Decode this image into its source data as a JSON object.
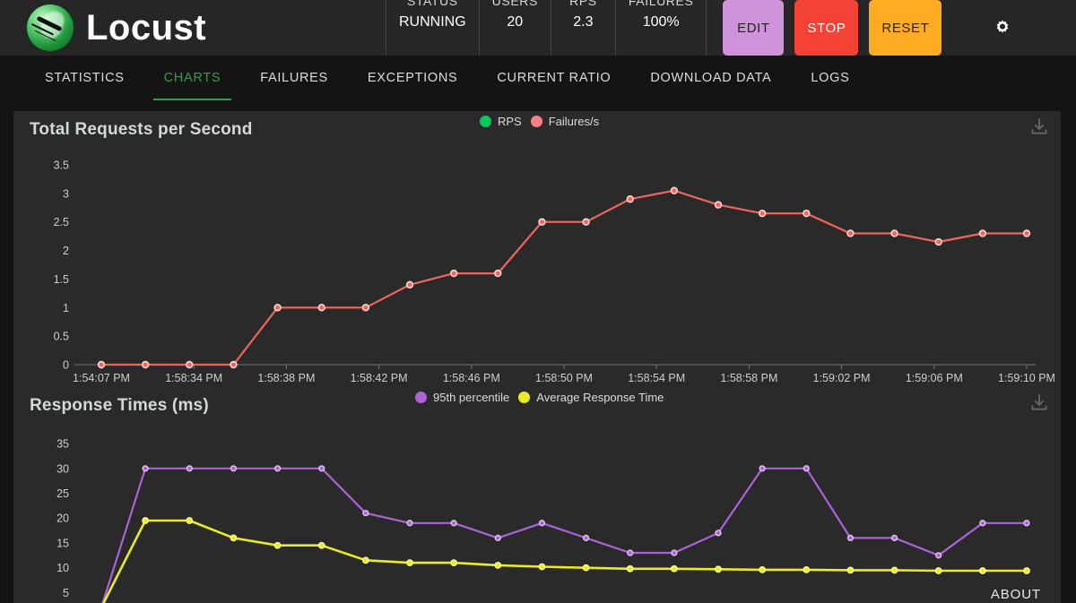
{
  "header": {
    "brand": "Locust",
    "logo_icon": "locust-logo",
    "stats": [
      {
        "label": "STATUS",
        "value": "RUNNING"
      },
      {
        "label": "USERS",
        "value": "20"
      },
      {
        "label": "RPS",
        "value": "2.3"
      },
      {
        "label": "FAILURES",
        "value": "100%"
      }
    ],
    "buttons": {
      "edit": "EDIT",
      "stop": "STOP",
      "reset": "RESET"
    },
    "settings_icon": "gear-icon",
    "colors": {
      "edit": "#ce93d8",
      "stop": "#f44336",
      "reset": "#ffab24",
      "header_bg": "#262626"
    }
  },
  "tabs": {
    "active": "CHARTS",
    "items": [
      {
        "label": "STATISTICS"
      },
      {
        "label": "CHARTS"
      },
      {
        "label": "FAILURES"
      },
      {
        "label": "EXCEPTIONS"
      },
      {
        "label": "CURRENT RATIO"
      },
      {
        "label": "DOWNLOAD DATA"
      },
      {
        "label": "LOGS"
      }
    ]
  },
  "footer": {
    "about_label": "ABOUT"
  },
  "charts": {
    "download_icon": "download-icon"
  },
  "chart_data": [
    {
      "type": "line",
      "title": "Total Requests per Second",
      "xlabel": "",
      "ylabel": "",
      "ylim": [
        0,
        3.5
      ],
      "yticks": [
        0,
        0.5,
        1,
        1.5,
        2,
        2.5,
        3,
        3.5
      ],
      "ytick_labels": [
        "0",
        "0.5",
        "1",
        "1.5",
        "2",
        "2.5",
        "3",
        "3.5"
      ],
      "grid": false,
      "legend_position": "top-center",
      "x": [
        "1:54:07 PM",
        "1:58:34 PM",
        "1:58:38 PM",
        "1:58:42 PM",
        "1:58:46 PM",
        "1:58:50 PM",
        "1:58:54 PM",
        "1:58:58 PM",
        "1:59:02 PM",
        "1:59:06 PM",
        "1:59:10 PM"
      ],
      "xtick_labels": [
        "1:54:07 PM",
        "1:58:34 PM",
        "1:58:38 PM",
        "1:58:42 PM",
        "1:58:46 PM",
        "1:58:50 PM",
        "1:58:54 PM",
        "1:58:58 PM",
        "1:59:02 PM",
        "1:59:06 PM",
        "1:59:10 PM"
      ],
      "series": [
        {
          "name": "RPS",
          "color": "#00ca5a",
          "values": []
        },
        {
          "name": "Failures/s",
          "color": "#ff6d6d",
          "values": [
            0,
            0,
            0,
            0,
            1,
            1,
            1,
            1.4,
            1.6,
            1.6,
            2.5,
            2.5,
            2.9,
            3.05,
            2.8,
            2.65,
            2.65,
            2.3,
            2.3,
            2.15,
            2.3,
            2.3
          ]
        }
      ]
    },
    {
      "type": "line",
      "title": "Response Times (ms)",
      "xlabel": "",
      "ylabel": "",
      "ylim": [
        2,
        37
      ],
      "yticks": [
        5,
        10,
        15,
        20,
        25,
        30,
        35
      ],
      "ytick_labels": [
        "5",
        "10",
        "15",
        "20",
        "25",
        "30",
        "35"
      ],
      "grid": false,
      "legend_position": "top-center",
      "series": [
        {
          "name": "95th percentile",
          "color": "#ab63d6",
          "values": [
            2,
            30,
            30,
            30,
            30,
            30,
            21,
            19,
            19,
            16,
            19,
            16,
            13,
            13,
            17,
            30,
            30,
            16,
            16,
            12.5,
            19,
            19
          ]
        },
        {
          "name": "Average Response Time",
          "color": "#eaec21",
          "values": [
            2,
            19.5,
            19.5,
            16,
            14.5,
            14.5,
            11.5,
            11,
            11,
            10.5,
            10.2,
            10,
            9.8,
            9.8,
            9.7,
            9.6,
            9.6,
            9.5,
            9.5,
            9.4,
            9.4,
            9.4
          ]
        }
      ]
    }
  ]
}
